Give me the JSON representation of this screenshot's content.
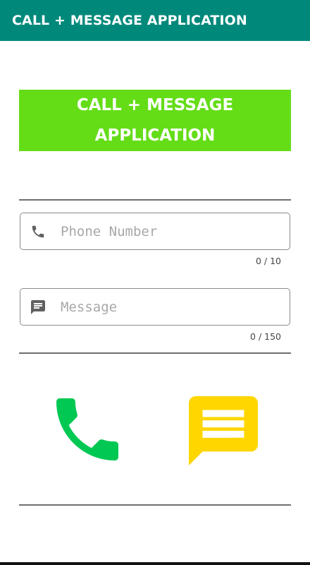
{
  "app_bar": {
    "title": "CALL + MESSAGE APPLICATION"
  },
  "banner": {
    "line1": "CALL + MESSAGE",
    "line2": "APPLICATION",
    "color": "#64dd17"
  },
  "phone_field": {
    "icon": "phone-icon",
    "value": "",
    "placeholder": "Phone Number",
    "counter": "0 / 10"
  },
  "message_field": {
    "icon": "message-icon",
    "value": "",
    "placeholder": "Message",
    "counter": "0 / 150"
  },
  "actions": {
    "call_icon": "call-icon",
    "call_color": "#00c853",
    "message_icon": "chat-icon",
    "message_color": "#ffd600"
  },
  "colors": {
    "app_bar": "#00897b",
    "divider": "#6f6f6f"
  }
}
